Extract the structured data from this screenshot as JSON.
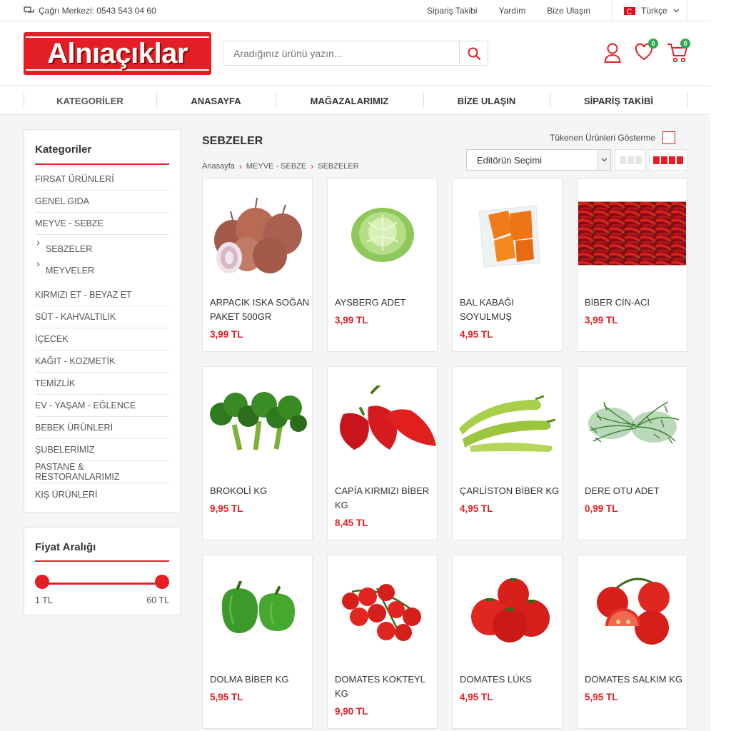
{
  "topbar": {
    "call_center": "Çağrı Merkezi: 0543 543 04 60",
    "links": [
      "Sipariş Takibi",
      "Yardım",
      "Bize Ulaşın"
    ],
    "language": "Türkçe"
  },
  "header": {
    "logo_text": "Alnıaçıklar",
    "search_placeholder": "Aradığınız ürünü yazın...",
    "wishlist_count": "0",
    "cart_count": "0"
  },
  "nav": {
    "items": [
      "KATEGORİLER",
      "ANASAYFA",
      "MAĞAZALARIMIZ",
      "BİZE ULAŞIN",
      "SİPARİŞ TAKİBİ"
    ]
  },
  "sidebar": {
    "categories_title": "Kategoriler",
    "categories": [
      "FIRSAT ÜRÜNLERİ",
      "GENEL GIDA",
      "MEYVE - SEBZE",
      "SEBZELER",
      "MEYVELER",
      "KIRMIZI ET - BEYAZ ET",
      "SÜT - KAHVALTILIK",
      "İÇECEK",
      "KAĞIT - KOZMETİK",
      "TEMİZLİK",
      "EV - YAŞAM - EĞLENCE",
      "BEBEK ÜRÜNLERİ",
      "ŞUBELERİMİZ",
      "PASTANE & RESTORANLARIMIZ",
      "KIŞ ÜRÜNLERİ"
    ],
    "price_title": "Fiyat Aralığı",
    "price_min": "1 TL",
    "price_max": "60 TL"
  },
  "main": {
    "title": "SEBZELER",
    "breadcrumb": [
      "Anasayfa",
      "MEYVE - SEBZE",
      "SEBZELER"
    ],
    "hide_out_of_stock": "Tükenen Ürünleri Gösterme",
    "sort_selected": "Editörün Seçimi"
  },
  "products": [
    {
      "name": "ARPACIK ISKA SOĞAN PAKET 500GR",
      "price": "3,99 TL",
      "icon": "shallot-image"
    },
    {
      "name": "AYSBERG ADET",
      "price": "3,99 TL",
      "icon": "lettuce-image"
    },
    {
      "name": "BAL KABAĞI SOYULMUŞ",
      "price": "4,95 TL",
      "icon": "pumpkin-image"
    },
    {
      "name": "BİBER CİN-ACI",
      "price": "3,99 TL",
      "icon": "chili-image"
    },
    {
      "name": "BROKOLİ KG",
      "price": "9,95 TL",
      "icon": "broccoli-image"
    },
    {
      "name": "CAPİA KIRMIZI BİBER KG",
      "price": "8,45 TL",
      "icon": "red-pepper-image"
    },
    {
      "name": "ÇARLİSTON BİBER KG",
      "price": "4,95 TL",
      "icon": "green-pepper-image"
    },
    {
      "name": "DERE OTU ADET",
      "price": "0,99 TL",
      "icon": "dill-image"
    },
    {
      "name": "DOLMA BİBER KG",
      "price": "5,95 TL",
      "icon": "bell-pepper-image"
    },
    {
      "name": "DOMATES KOKTEYL KG",
      "price": "9,90 TL",
      "icon": "cherry-tomato-image"
    },
    {
      "name": "DOMATES LÜKS",
      "price": "4,95 TL",
      "icon": "tomato-image"
    },
    {
      "name": "DOMATES SALKIM KG",
      "price": "5,95 TL",
      "icon": "vine-tomato-image"
    }
  ]
}
